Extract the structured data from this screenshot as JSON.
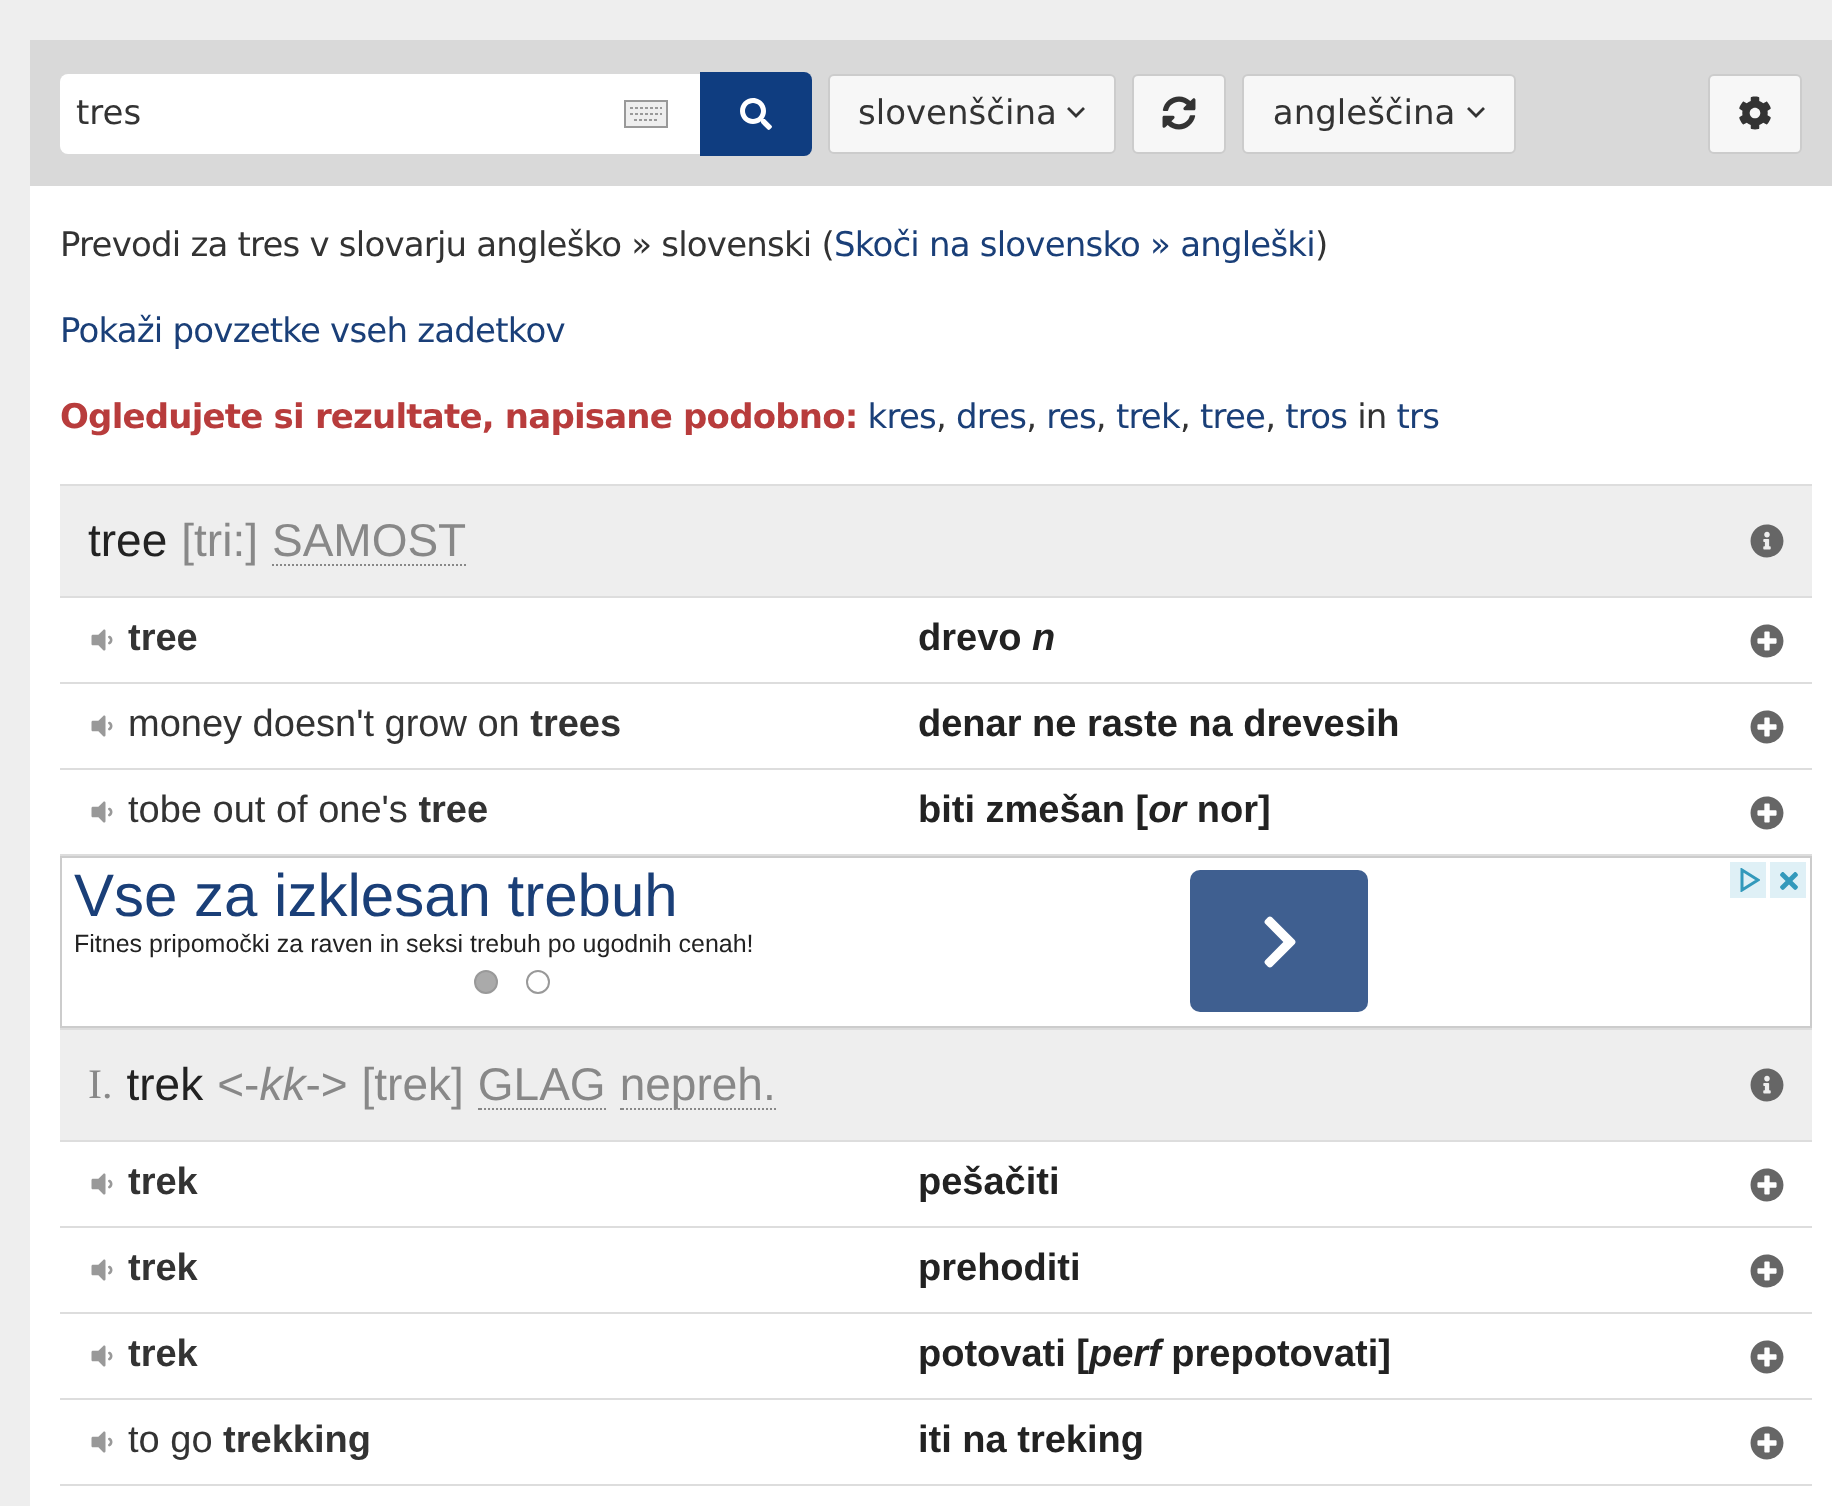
{
  "search": {
    "value": "tres",
    "source_language": "slovenščina",
    "target_language": "angleščina"
  },
  "intro": {
    "prefix": "Prevodi za tres v slovarju angleško » slovenski (",
    "link": "Skoči na slovensko » angleški",
    "suffix": ")"
  },
  "summary_link": "Pokaži povzetke vseh zadetkov",
  "suggestions": {
    "label": "Ogledujete si rezultate, napisane podobno:",
    "words": [
      {
        "text": "kres",
        "sep": ","
      },
      {
        "text": "dres",
        "sep": ","
      },
      {
        "text": "res",
        "sep": ","
      },
      {
        "text": "trek",
        "sep": ","
      },
      {
        "text": "tree",
        "sep": ","
      },
      {
        "text": "tros"
      }
    ],
    "conjunction": "in",
    "last": "trs"
  },
  "entries": [
    {
      "headword": "tree",
      "extras": [
        {
          "kind": "pron",
          "text": "[tri:]"
        },
        {
          "kind": "abbr",
          "text": "SAMOST"
        }
      ],
      "rows": [
        {
          "source": "**tree**",
          "target": "drevo *n*"
        },
        {
          "source": "money doesn't grow on **trees**",
          "target": "denar ne raste na drevesih"
        },
        {
          "source": "tobe out of one's **tree**",
          "target": "biti zmešan [*or* nor]"
        }
      ]
    },
    {
      "kind": "ad",
      "title": "Vse za izklesan trebuh",
      "text": "Fitnes pripomočki za raven in seksi trebuh po ugodnih cenah!",
      "dots": [
        {
          "selected": true
        },
        {
          "selected": false
        }
      ]
    },
    {
      "numeral": "I.",
      "headword": "trek",
      "extras": [
        {
          "kind": "inflection",
          "text": "<-*kk*->"
        },
        {
          "kind": "pron",
          "text": "[trek]"
        },
        {
          "kind": "abbr",
          "text": "GLAG"
        },
        {
          "kind": "abbr",
          "text": "nepreh."
        }
      ],
      "rows": [
        {
          "source": "**trek**",
          "target": "pešačiti"
        },
        {
          "source": "**trek**",
          "target": "prehoditi"
        },
        {
          "source": "**trek**",
          "target": "potovati [*perf* prepotovati]"
        },
        {
          "source": "to go **trekking**",
          "target": "iti na treking"
        }
      ]
    }
  ]
}
